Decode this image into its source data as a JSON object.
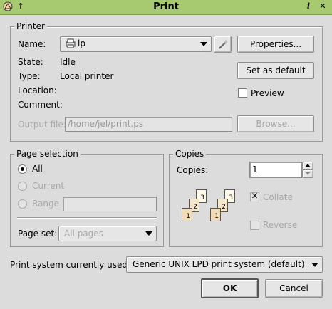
{
  "window": {
    "title": "Print"
  },
  "printer": {
    "group_label": "Printer",
    "name_label": "Name:",
    "name_value": "lp",
    "state_label": "State:",
    "state_value": "Idle",
    "type_label": "Type:",
    "type_value": "Local printer",
    "location_label": "Location:",
    "location_value": "",
    "comment_label": "Comment:",
    "comment_value": "",
    "output_file_label": "Output file:",
    "output_file_value": "/home/jel/print.ps",
    "properties_button": "Properties...",
    "default_button": "Set as default",
    "browse_button": "Browse...",
    "preview_label": "Preview",
    "preview_checked": false
  },
  "page_selection": {
    "group_label": "Page selection",
    "all_label": "All",
    "current_label": "Current",
    "range_label": "Range",
    "range_value": "",
    "selected": "All",
    "page_set_label": "Page set:",
    "page_set_value": "All pages"
  },
  "copies": {
    "group_label": "Copies",
    "copies_label": "Copies:",
    "copies_value": "1",
    "collate_label": "Collate",
    "collate_checked": true,
    "reverse_label": "Reverse",
    "reverse_checked": false,
    "page_numbers": [
      "1",
      "2",
      "3"
    ]
  },
  "print_system": {
    "label": "Print system currently used:",
    "value": "Generic UNIX LPD print system (default)"
  },
  "buttons": {
    "ok": "OK",
    "cancel": "Cancel"
  },
  "colors": {
    "titlebar": "#a7c96f",
    "dialog_bg": "#dcdcdc"
  }
}
